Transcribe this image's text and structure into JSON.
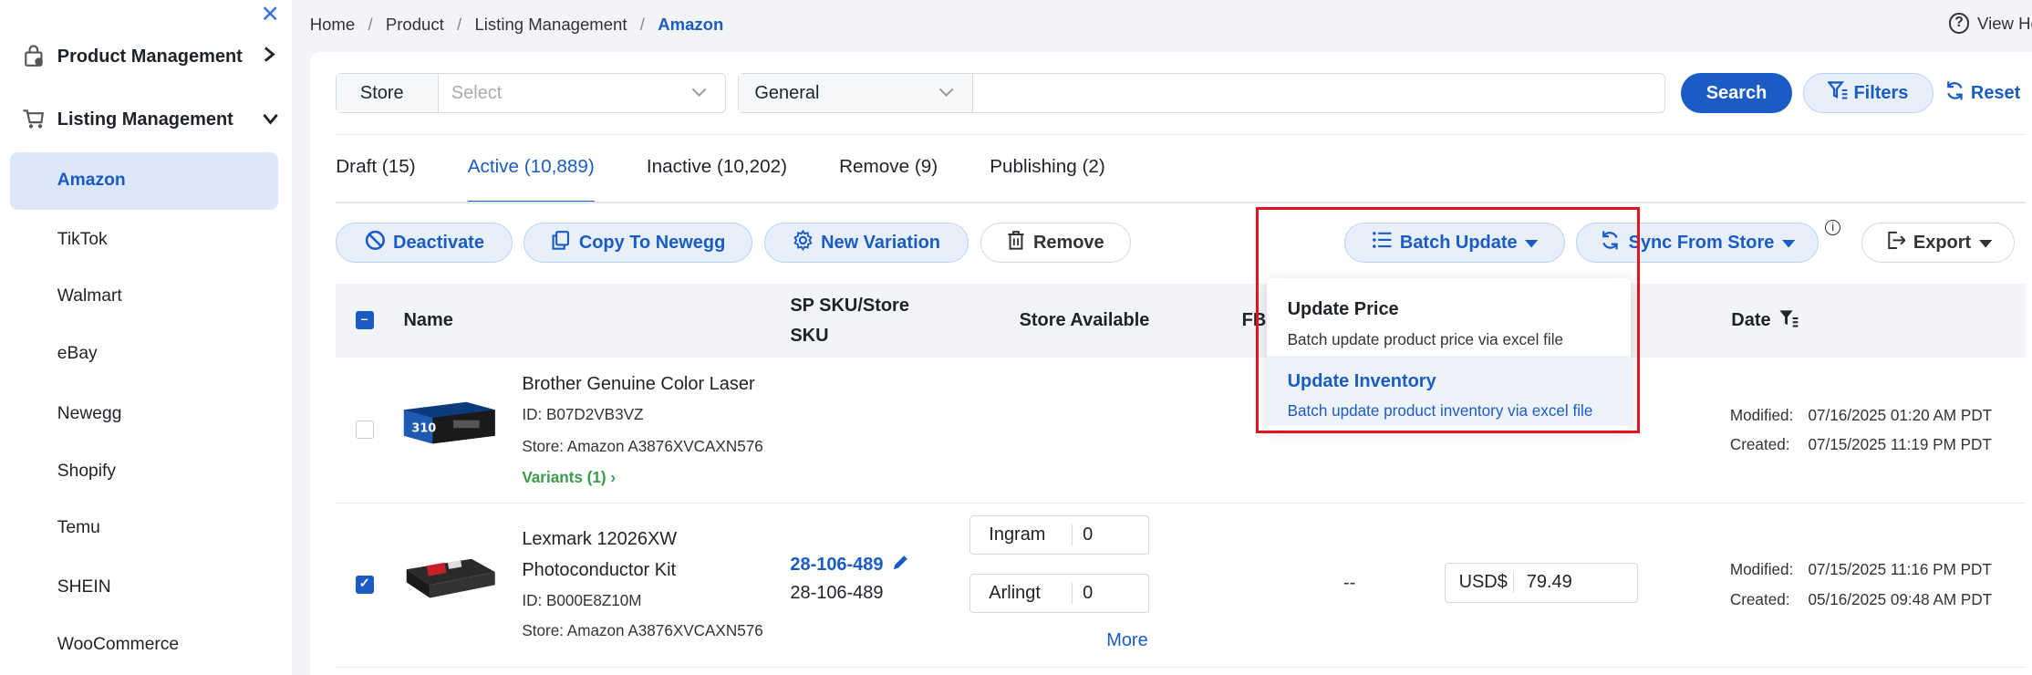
{
  "sidebar": {
    "groups": [
      {
        "label": "Product Management",
        "icon": "box-icon"
      },
      {
        "label": "Listing Management",
        "icon": "cart-icon"
      }
    ],
    "items": [
      "Amazon",
      "TikTok",
      "Walmart",
      "eBay",
      "Newegg",
      "Shopify",
      "Temu",
      "SHEIN",
      "WooCommerce"
    ],
    "active": "Amazon"
  },
  "breadcrumb": [
    "Home",
    "Product",
    "Listing Management",
    "Amazon"
  ],
  "help_label": "View He",
  "search": {
    "store_label": "Store",
    "store_placeholder": "Select",
    "field_select": "General",
    "query": "",
    "search_label": "Search",
    "filters_label": "Filters",
    "reset_label": "Reset"
  },
  "tabs": [
    {
      "label": "Draft (15)"
    },
    {
      "label": "Active (10,889)",
      "active": true
    },
    {
      "label": "Inactive (10,202)"
    },
    {
      "label": "Remove (9)"
    },
    {
      "label": "Publishing (2)"
    }
  ],
  "actions": {
    "deactivate": "Deactivate",
    "copy": "Copy To Newegg",
    "variation": "New Variation",
    "remove": "Remove",
    "batch_update": "Batch Update",
    "sync": "Sync From Store",
    "export": "Export"
  },
  "table": {
    "headers": {
      "name": "Name",
      "sku_1": "SP SKU/Store",
      "sku_2": "SKU",
      "store_available": "Store Available",
      "fba": "FB",
      "date": "Date"
    },
    "rows": [
      {
        "name": "Brother Genuine Color Laser",
        "id": "ID: B07D2VB3VZ",
        "store": "Store: Amazon A3876XVCAXN576",
        "variants": "Variants (1)",
        "modified_label": "Modified:",
        "modified": "07/16/2025 01:20 AM PDT",
        "created_label": "Created:",
        "created": "07/15/2025 11:19 PM PDT",
        "checked": false
      },
      {
        "name_1": "Lexmark 12026XW",
        "name_2": "Photoconductor Kit",
        "id": "ID: B000E8Z10M",
        "store": "Store: Amazon A3876XVCAXN576",
        "sp_sku": "28-106-489",
        "store_sku": "28-106-489",
        "inventory": [
          {
            "warehouse": "Ingram",
            "qty": "0"
          },
          {
            "warehouse": "Arlingt",
            "qty": "0"
          }
        ],
        "more": "More",
        "fba": "--",
        "currency": "USD$",
        "price": "79.49",
        "modified_label": "Modified:",
        "modified": "07/15/2025 11:16 PM PDT",
        "created_label": "Created:",
        "created": "05/16/2025 09:48 AM PDT",
        "checked": true
      }
    ]
  },
  "dropdown": {
    "items": [
      {
        "title": "Update Price",
        "desc": "Batch update product price via excel file"
      },
      {
        "title": "Update Inventory",
        "desc": "Batch update product inventory via excel file",
        "highlighted": true
      }
    ]
  },
  "colors": {
    "accent": "#1b5cc4",
    "highlight_box": "#e3141b",
    "variants": "#3c9a4a"
  }
}
